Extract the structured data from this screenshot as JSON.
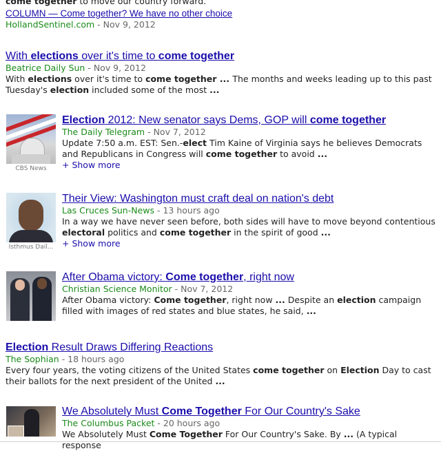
{
  "top_line": {
    "prefix": "come together",
    "rest": " to move our country forward."
  },
  "column_result": {
    "title": "COLUMN — Come together? We have no other choice",
    "source": "HollandSentinel.com",
    "date": " - Nov 9, 2012"
  },
  "results": [
    {
      "title_parts": [
        [
          "With ",
          false
        ],
        [
          "elections",
          true
        ],
        [
          " over it's time to ",
          false
        ],
        [
          "come together",
          true
        ]
      ],
      "source": "Beatrice Daily Sun",
      "date": " - Nov 9, 2012",
      "snippet_parts": [
        [
          "With ",
          false
        ],
        [
          "elections",
          true
        ],
        [
          " over it's time to ",
          false
        ],
        [
          "come together",
          true
        ],
        [
          " ... ",
          true
        ],
        [
          "The months and weeks leading up to this past Tuesday's ",
          false
        ],
        [
          "election",
          true
        ],
        [
          " included some of the most ",
          false
        ],
        [
          "...",
          true
        ]
      ]
    },
    {
      "title_parts": [
        [
          "Election",
          true
        ],
        [
          " 2012: New senator says Dems, GOP will ",
          false
        ],
        [
          "come together",
          true
        ]
      ],
      "source": "The Daily Telegram",
      "date": " - Nov 7, 2012",
      "snippet_parts": [
        [
          "Update 7:50 a.m. EST: Sen.-",
          false
        ],
        [
          "elect",
          true
        ],
        [
          " Tim Kaine of Virginia says he believes Democrats and Republicans in Congress will ",
          false
        ],
        [
          "come together",
          true
        ],
        [
          " to avoid ",
          false
        ],
        [
          "...",
          true
        ]
      ],
      "more": "+ Show more",
      "thumb_caption": "CBS News"
    },
    {
      "title_parts": [
        [
          "Their View: Washington must craft deal on nation's debt",
          false
        ]
      ],
      "source": "Las Cruces Sun-News",
      "date": " - 13 hours ago",
      "snippet_parts": [
        [
          "In a way we have never seen before, both sides will have to move beyond contentious ",
          false
        ],
        [
          "electoral",
          true
        ],
        [
          " politics and ",
          false
        ],
        [
          "come together",
          true
        ],
        [
          " in the spirit of good ",
          false
        ],
        [
          "...",
          true
        ]
      ],
      "more": "+ Show more",
      "thumb_caption": "Isthmus Dail..."
    },
    {
      "title_parts": [
        [
          "After Obama victory: ",
          false
        ],
        [
          "Come together",
          true
        ],
        [
          ", right now",
          false
        ]
      ],
      "source": "Christian Science Monitor",
      "date": " - Nov 7, 2012",
      "snippet_parts": [
        [
          "After Obama victory: ",
          false
        ],
        [
          "Come together",
          true
        ],
        [
          ", right now ",
          false
        ],
        [
          "...",
          true
        ],
        [
          " Despite an ",
          false
        ],
        [
          "election",
          true
        ],
        [
          " campaign filled with images of red states and blue states, he said, ",
          false
        ],
        [
          "...",
          true
        ]
      ]
    },
    {
      "title_parts": [
        [
          "Election",
          true
        ],
        [
          " Result Draws Differing Reactions",
          false
        ]
      ],
      "source": "The Sophian",
      "date": " - 18 hours ago",
      "snippet_parts": [
        [
          "Every four years, the voting citizens of the United States ",
          false
        ],
        [
          "come together",
          true
        ],
        [
          " on ",
          false
        ],
        [
          "Election",
          true
        ],
        [
          " Day to cast their ballots for the next president of the United ",
          false
        ],
        [
          "...",
          true
        ]
      ]
    },
    {
      "title_parts": [
        [
          "We Absolutely Must ",
          false
        ],
        [
          "Come Together",
          true
        ],
        [
          " For Our Country's Sake",
          false
        ]
      ],
      "source": "The Columbus Packet",
      "date": " - 20 hours ago",
      "snippet_parts": [
        [
          "We Absolutely Must ",
          false
        ],
        [
          "Come Together",
          true
        ],
        [
          " For Our Country's Sake. By ",
          false
        ],
        [
          "...",
          true
        ],
        [
          " (A typical response",
          false
        ]
      ]
    }
  ]
}
